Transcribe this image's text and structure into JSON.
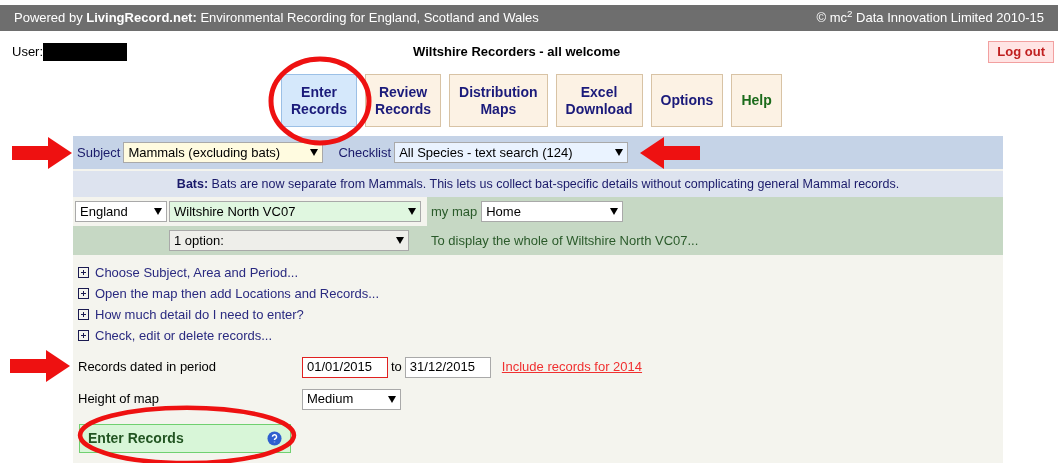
{
  "header": {
    "text": "Powered by **LivingRecord.net:** Environmental Recording for England, Scotland and Wales",
    "copyright": "© mc$^{2}$ Data Innovation Limited 2010-15"
  },
  "user": {
    "label": "User:"
  },
  "site_title": "Wiltshire Recorders - all welcome",
  "logout": "Log out",
  "nav": [
    {
      "label": "Enter Records",
      "selected": true,
      "kind": "page"
    },
    {
      "label": "Review Records",
      "selected": false,
      "kind": "page"
    },
    {
      "label": "Distribution Maps",
      "selected": false,
      "kind": "page"
    },
    {
      "label": "Excel Download",
      "selected": false,
      "kind": "page"
    },
    {
      "label": "Options",
      "selected": false,
      "kind": "page"
    },
    {
      "label": "Help",
      "selected": false,
      "kind": "help"
    }
  ],
  "subject": {
    "label": "Subject",
    "value": "Mammals (excluding bats)"
  },
  "checklist": {
    "label": "Checklist",
    "value": "All Species - text search (124)"
  },
  "notice": "**Bats:** Bats are now separate from Mammals. This lets us collect bat-specific details without complicating general Mammal records.",
  "area": {
    "country": "England",
    "region": "Wiltshire North VC07",
    "map_label": "my map",
    "map": "Home",
    "option": "1 option:",
    "hint": "To display the whole of Wiltshire North VC07..."
  },
  "expanders": [
    "Choose Subject, Area and Period...",
    "Open the map then add Locations and Records...",
    "How much detail do I need to enter?",
    "Check, edit or delete records..."
  ],
  "period": {
    "label": "Records dated in period",
    "from": "01/01/2015",
    "to_label": "to",
    "to": "31/12/2015",
    "link": "Include records for 2014"
  },
  "map_height": {
    "label": "Height of map",
    "value": "Medium"
  },
  "enter_button": "Enter Records"
}
